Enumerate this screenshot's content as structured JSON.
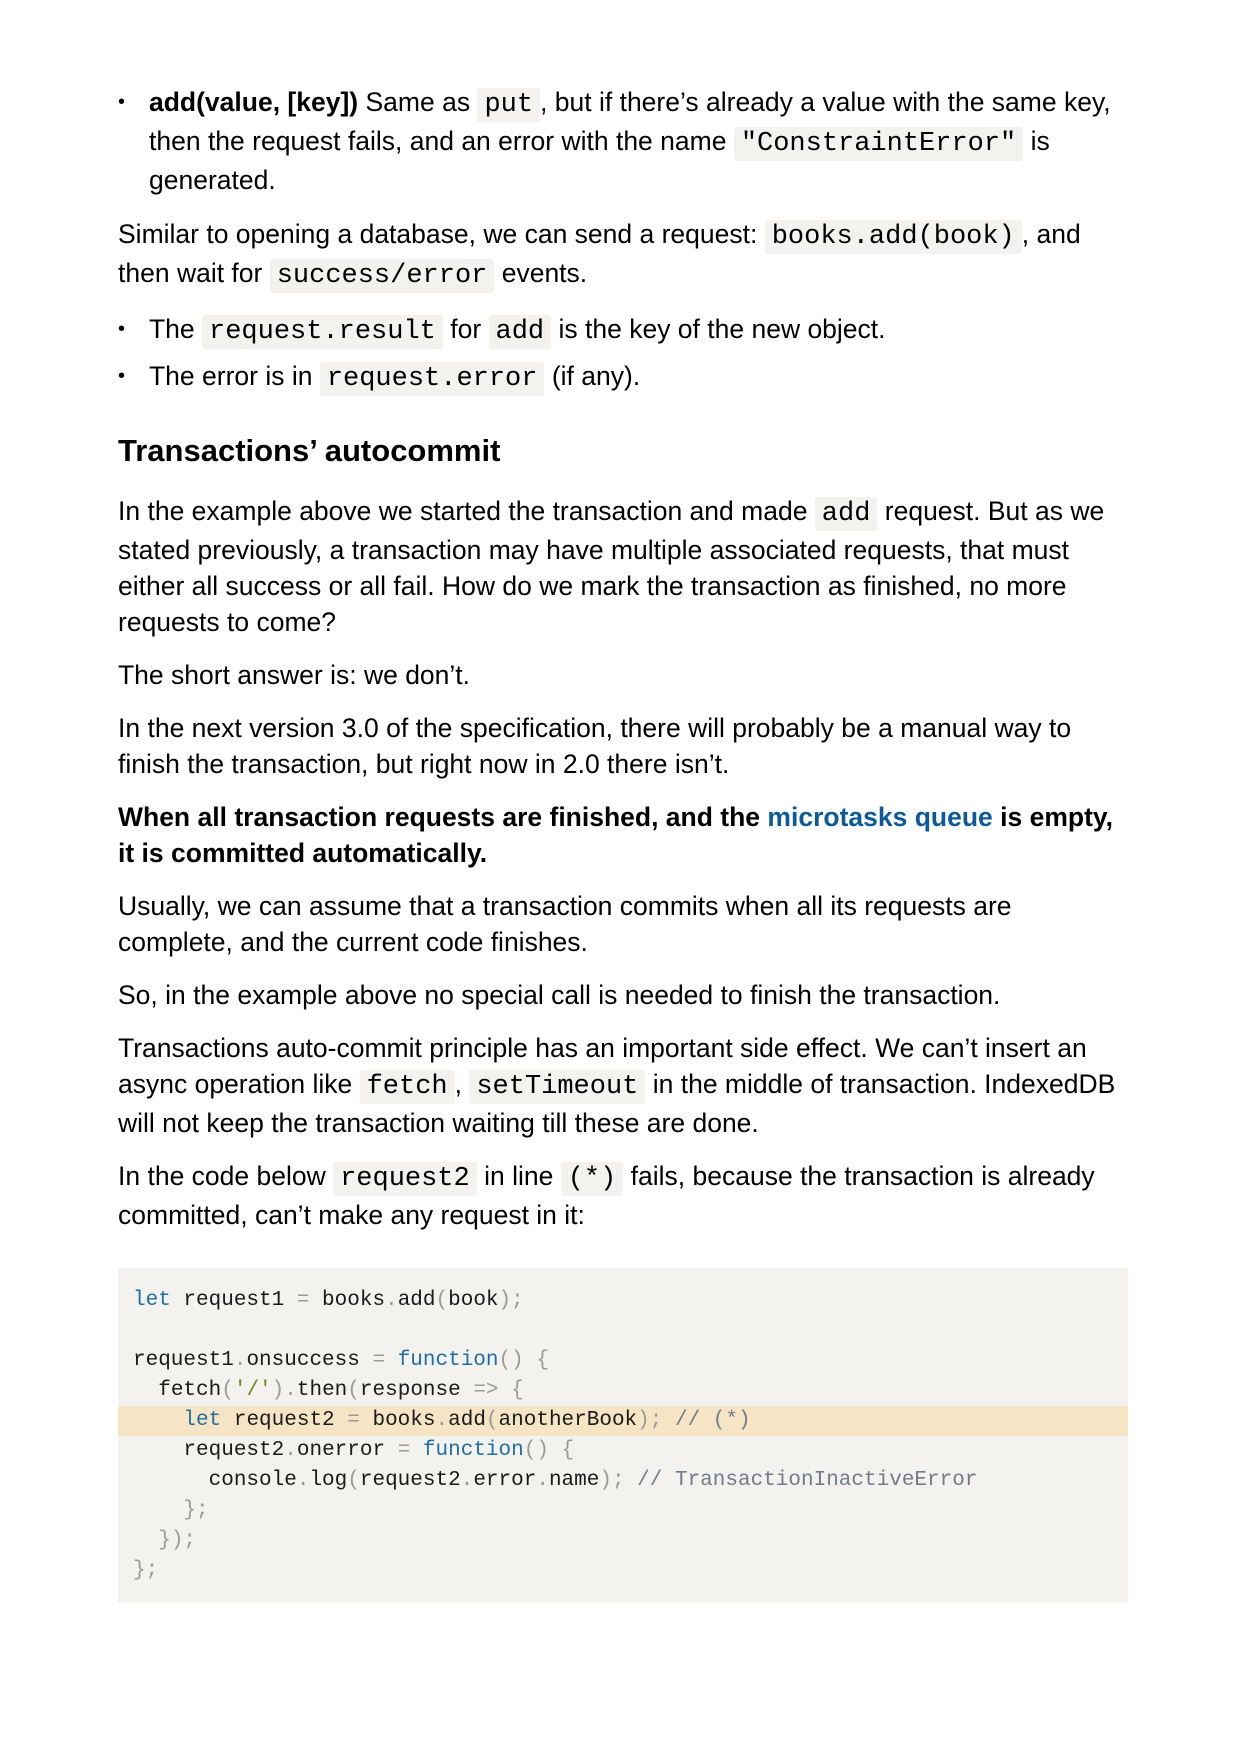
{
  "bullets_top": [
    {
      "bold": "add(value, [key])",
      "t1": " Same as ",
      "c1": "put",
      "t2": ", but if there’s already a value with the same key, then the request fails, and an error with the name ",
      "c2": "\"ConstraintError\"",
      "t3": " is generated."
    }
  ],
  "para_send": {
    "t1": "Similar to opening a database, we can send a request: ",
    "c1": "books.add(book)",
    "t2": ", and then wait for ",
    "c2": "success/error",
    "t3": " events."
  },
  "bullets_result": [
    {
      "t1": "The ",
      "c1": "request.result",
      "t2": " for ",
      "c2": "add",
      "t3": " is the key of the new object."
    },
    {
      "t1": "The error is in ",
      "c1": "request.error",
      "t2": " (if any)."
    }
  ],
  "heading": "Transactions’ autocommit",
  "para_example": {
    "t1": "In the example above we started the transaction and made ",
    "c1": "add",
    "t2": " request. But as we stated previously, a transaction may have multiple associated requests, that must either all success or all fail. How do we mark the transaction as finished, no more requests to come?"
  },
  "para_short": "The short answer is: we don’t.",
  "para_next": "In the next version 3.0 of the specification, there will probably be a manual way to finish the transaction, but right now in 2.0 there isn’t.",
  "para_bold": {
    "t1": "When all transaction requests are finished, and the ",
    "link": "microtasks queue",
    "t2": " is empty, it is committed automatically."
  },
  "para_usually": "Usually, we can assume that a transaction commits when all its requests are complete, and the current code finishes.",
  "para_so": "So, in the example above no special call is needed to finish the transaction.",
  "para_principle": {
    "t1": "Transactions auto-commit principle has an important side effect. We can’t insert an async operation like ",
    "c1": "fetch",
    "t2": ", ",
    "c2": "setTimeout",
    "t3": " in the middle of transaction. IndexedDB will not keep the transaction waiting till these are done."
  },
  "para_code_below": {
    "t1": "In the code below ",
    "c1": "request2",
    "t2": " in line ",
    "c2": "(*)",
    "t3": " fails, because the transaction is already committed, can’t make any request in it:"
  },
  "code": {
    "line1": {
      "kw": "let",
      "a": " request1 ",
      "op1": "=",
      "b": " books",
      "op2": ".",
      "c": "add",
      "op3": "(",
      "d": "book",
      "op4": ");"
    },
    "line3": {
      "a": "request1",
      "op1": ".",
      "b": "onsuccess ",
      "op2": "=",
      "sp": " ",
      "kw": "function",
      "op3": "() {"
    },
    "line4": {
      "ind": "  ",
      "a": "fetch",
      "op1": "(",
      "st": "'/'",
      "op2": ").",
      "b": "then",
      "op3": "(",
      "c": "response ",
      "op4": "=> {"
    },
    "line5": {
      "ind": "    ",
      "kw": "let",
      "a": " request2 ",
      "op1": "=",
      "b": " books",
      "op2": ".",
      "c": "add",
      "op3": "(",
      "d": "anotherBook",
      "op4": "); ",
      "cm": "// (*)"
    },
    "line6": {
      "ind": "    ",
      "a": "request2",
      "op1": ".",
      "b": "onerror ",
      "op2": "=",
      "sp": " ",
      "kw": "function",
      "op3": "() {"
    },
    "line7": {
      "ind": "      ",
      "a": "console",
      "op1": ".",
      "b": "log",
      "op2": "(",
      "c": "request2",
      "op3": ".",
      "d": "error",
      "op4": ".",
      "e": "name",
      "op5": "); ",
      "cm": "// TransactionInactiveError"
    },
    "line8": {
      "ind": "    ",
      "op": "};"
    },
    "line9": {
      "ind": "  ",
      "op": "});"
    },
    "line10": {
      "op": "};"
    }
  }
}
